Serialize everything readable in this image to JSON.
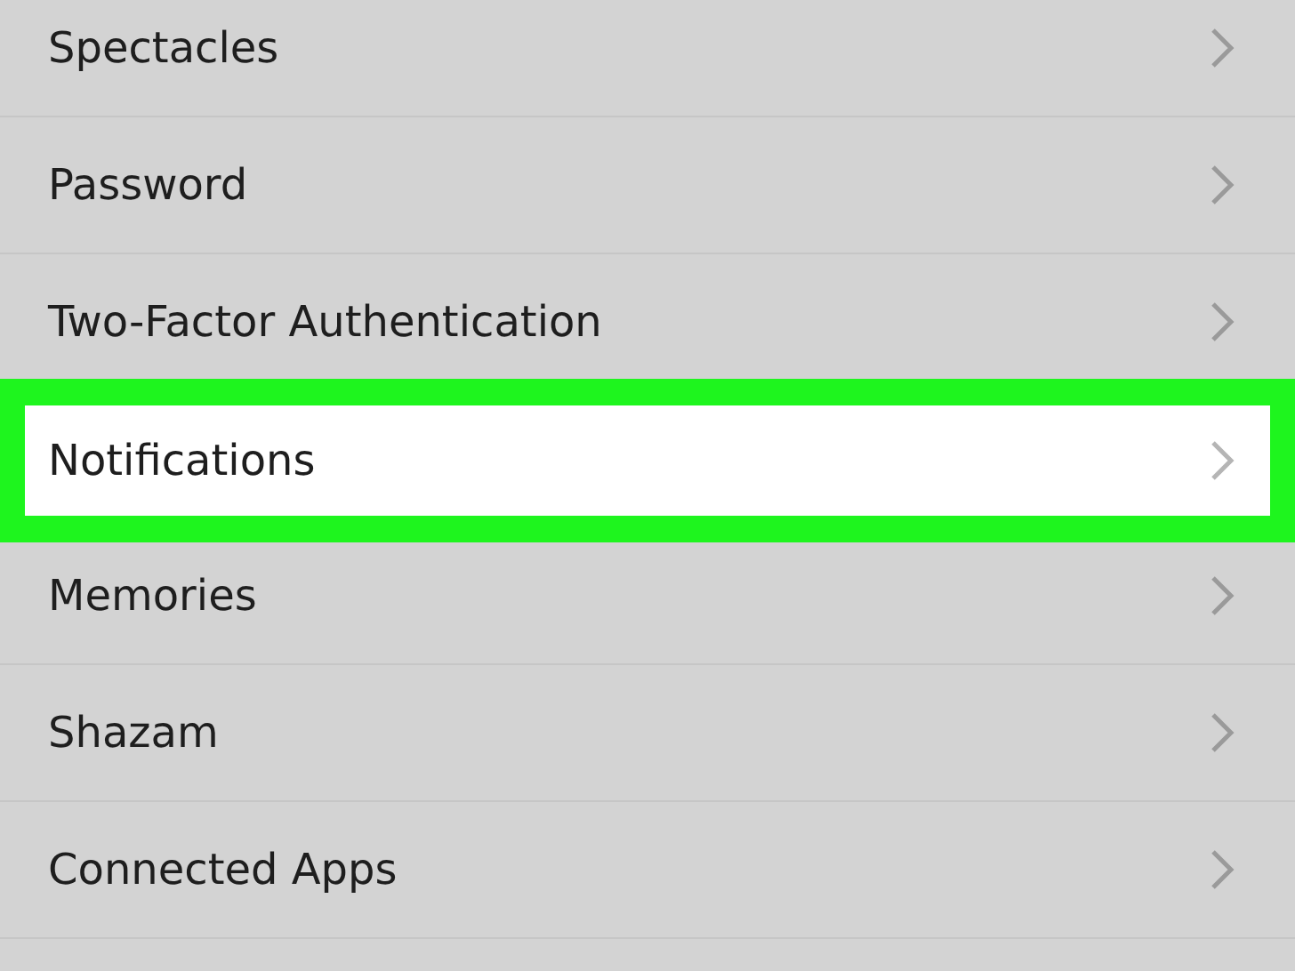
{
  "rows": [
    {
      "label": "Spectacles",
      "selected": false
    },
    {
      "label": "Password",
      "selected": false
    },
    {
      "label": "Two-Factor Authentication",
      "selected": false
    },
    {
      "label": "Notifications",
      "selected": true
    },
    {
      "label": "Memories",
      "selected": false
    },
    {
      "label": "Shazam",
      "selected": false
    },
    {
      "label": "Connected Apps",
      "selected": false
    }
  ]
}
